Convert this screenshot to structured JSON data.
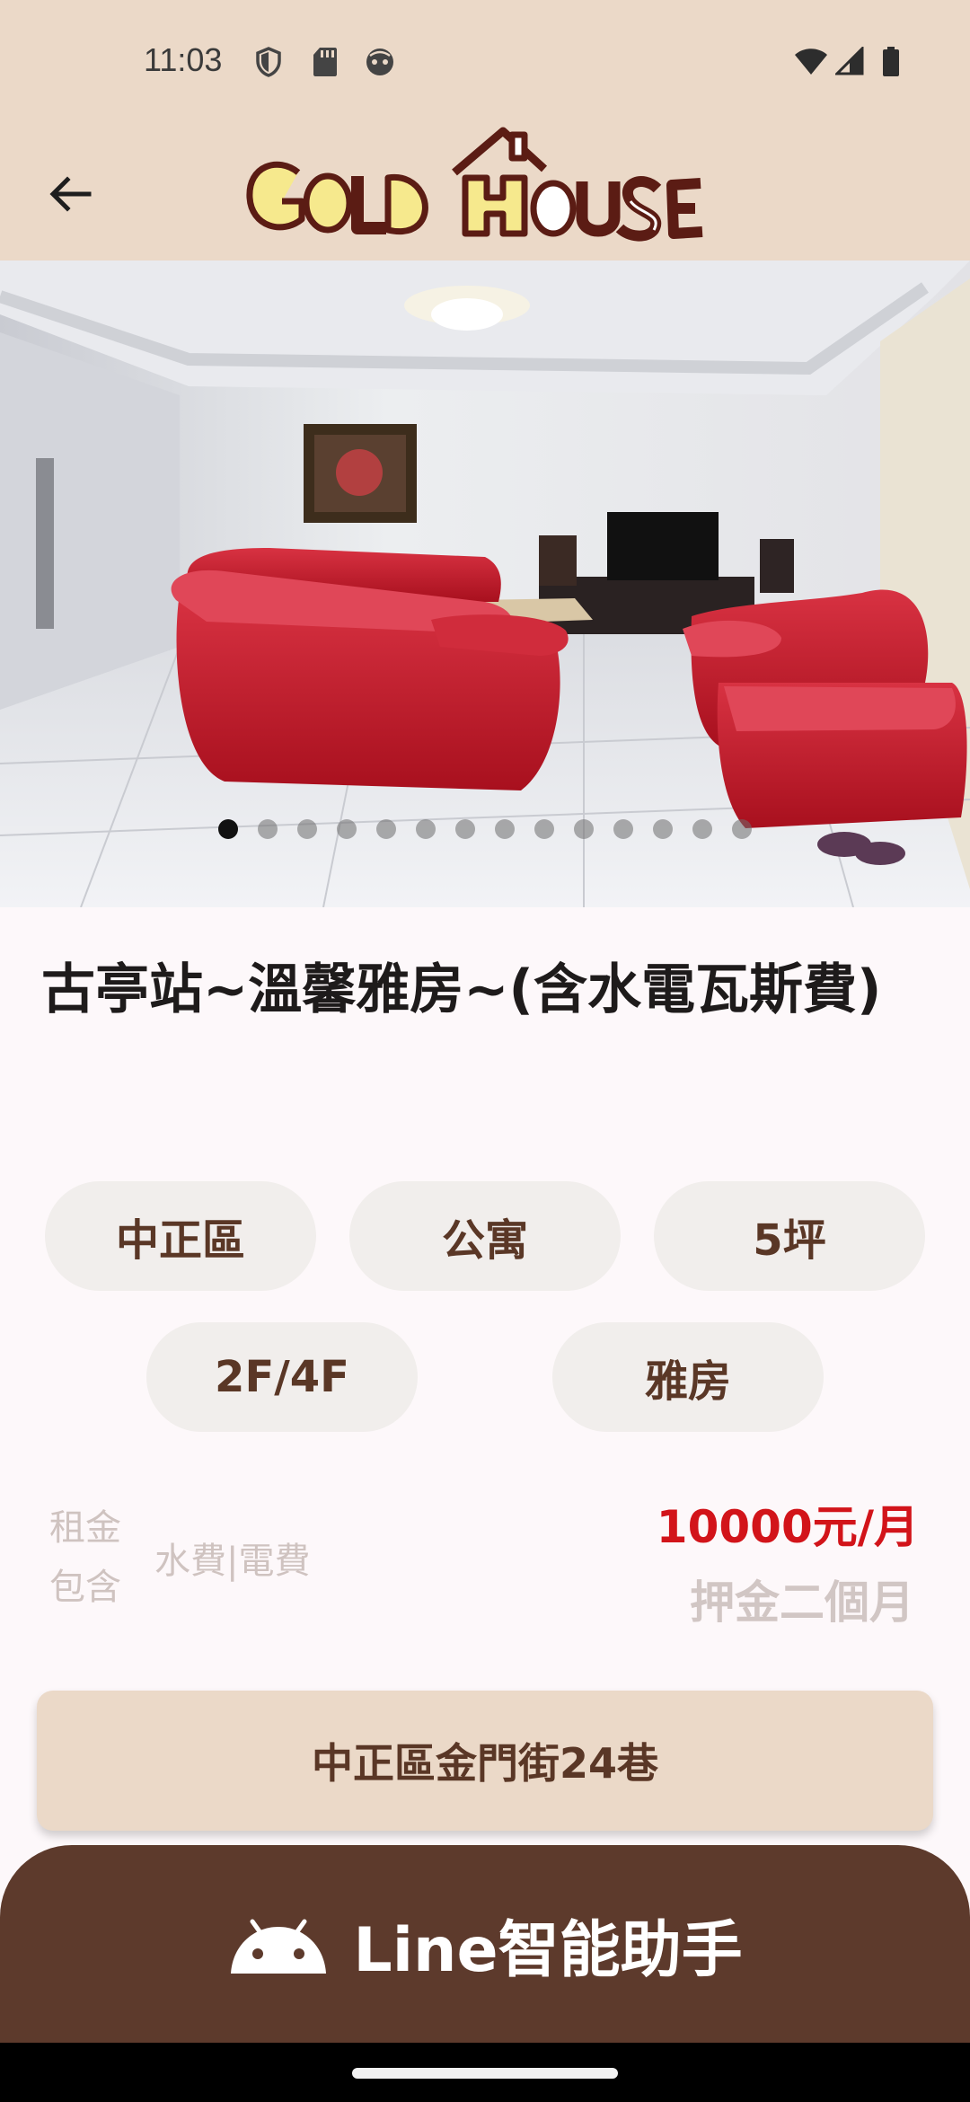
{
  "status_bar": {
    "time": "11:03"
  },
  "listing": {
    "title": "古亭站~溫馨雅房~(含水電瓦斯費)",
    "chips": [
      "中正區",
      "公寓",
      "5坪",
      "2F/4F",
      "雅房"
    ],
    "rent_label": "租金包含",
    "included": "水費|電費",
    "price": "10000元/月",
    "deposit": "押金二個月",
    "address": "中正區金門街24巷"
  },
  "gallery": {
    "total_images": 14,
    "active_index": 0
  },
  "line_button": {
    "label": "Line智能助手"
  },
  "colors": {
    "header_bg": "#ebd9c8",
    "brown": "#5d3a2c",
    "price_red": "#d2141a",
    "chip_bg": "#f1eeec"
  }
}
